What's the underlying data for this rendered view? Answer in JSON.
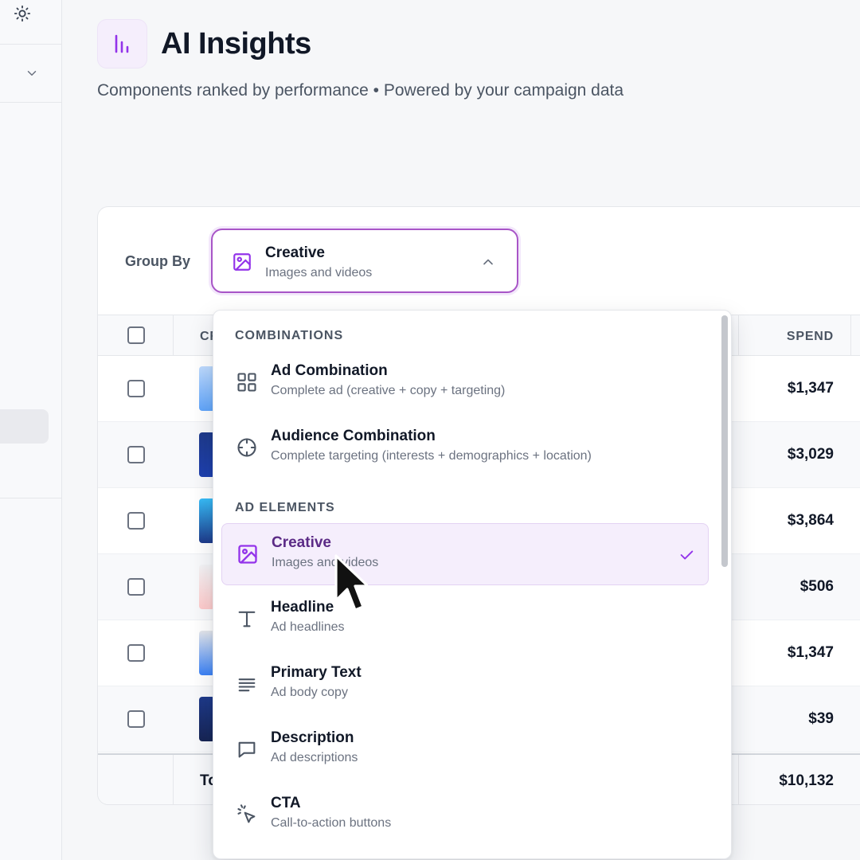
{
  "header": {
    "title": "AI Insights",
    "subtitle": "Components ranked by performance • Powered by your campaign data",
    "logo_icon": "bar-chart-icon",
    "accent": "#9333ea"
  },
  "sidebar": {
    "top_icon": "sun-icon",
    "collapse_icon": "chevron-down-icon"
  },
  "group_by": {
    "label": "Group By",
    "selected_title": "Creative",
    "selected_sub": "Images and videos"
  },
  "table": {
    "header_first": "CR",
    "spend_header": "SPEND",
    "rows": [
      {
        "spend": "$1,347"
      },
      {
        "spend": "$3,029"
      },
      {
        "spend": "$3,864"
      },
      {
        "spend": "$506"
      },
      {
        "spend": "$1,347"
      },
      {
        "spend": "$39"
      }
    ],
    "total_label": "To",
    "total_spend": "$10,132"
  },
  "dropdown": {
    "sections": [
      "COMBINATIONS",
      "AD ELEMENTS"
    ],
    "options": [
      {
        "title": "Ad Combination",
        "sub": "Complete ad (creative + copy + targeting)",
        "icon": "grid-icon"
      },
      {
        "title": "Audience Combination",
        "sub": "Complete targeting (interests + demographics + location)",
        "icon": "crosshair-icon"
      },
      {
        "title": "Creative",
        "sub": "Images and videos",
        "icon": "image-icon",
        "selected": true
      },
      {
        "title": "Headline",
        "sub": "Ad headlines",
        "icon": "type-icon"
      },
      {
        "title": "Primary Text",
        "sub": "Ad body copy",
        "icon": "align-left-icon"
      },
      {
        "title": "Description",
        "sub": "Ad descriptions",
        "icon": "message-icon"
      },
      {
        "title": "CTA",
        "sub": "Call-to-action buttons",
        "icon": "pointer-click-icon"
      }
    ]
  }
}
